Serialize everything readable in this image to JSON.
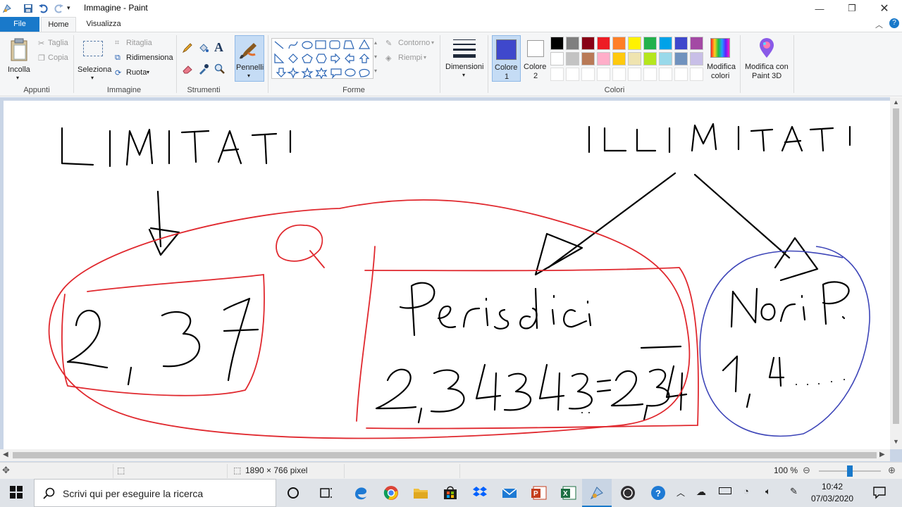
{
  "window": {
    "title": "Immagine - Paint"
  },
  "tabs": [
    {
      "label": "File"
    },
    {
      "label": "Home"
    },
    {
      "label": "Visualizza"
    }
  ],
  "ribbon": {
    "appunti": {
      "group_label": "Appunti",
      "paste_label": "Incolla",
      "cut_label": "Taglia",
      "copy_label": "Copia"
    },
    "immagine": {
      "group_label": "Immagine",
      "select_label": "Seleziona",
      "crop_label": "Ritaglia",
      "resize_label": "Ridimensiona",
      "rotate_label": "Ruota"
    },
    "strumenti": {
      "group_label": "Strumenti"
    },
    "brushes_label": "Pennelli",
    "forme": {
      "group_label": "Forme",
      "outline_label": "Contorno",
      "fill_label": "Riempi"
    },
    "size_label": "Dimensioni",
    "color1": {
      "label_line1": "Colore",
      "label_line2": "1",
      "value": "#3f48cc"
    },
    "color2": {
      "label_line1": "Colore",
      "label_line2": "2",
      "value": "#ffffff"
    },
    "colori": {
      "group_label": "Colori",
      "edit_colors_line1": "Modifica",
      "edit_colors_line2": "colori",
      "paint3d_line1": "Modifica con",
      "paint3d_line2": "Paint 3D",
      "palette_row1": [
        "#000000",
        "#7f7f7f",
        "#880015",
        "#ed1c24",
        "#ff7f27",
        "#fff200",
        "#22b14c",
        "#00a2e8",
        "#3f48cc",
        "#a349a4"
      ],
      "palette_row2": [
        "#ffffff",
        "#c3c3c3",
        "#b97a57",
        "#ffaec9",
        "#ffc90e",
        "#efe4b0",
        "#b5e61d",
        "#99d9ea",
        "#7092be",
        "#c8bfe7"
      ]
    }
  },
  "status": {
    "image_size": "1890 × 766 pixel",
    "zoom": "100 %",
    "zoom_level": 1.0
  },
  "taskbar": {
    "search_placeholder": "Scrivi qui per eseguire la ricerca",
    "time": "10:42",
    "date": "07/03/2020"
  },
  "canvas": {
    "drawn_text": [
      "LIMITATI",
      "ILLIMITATI",
      "2,37",
      "Periodici",
      "2,343434=2,34",
      "Non P.",
      "1,4......"
    ],
    "ink_colors": {
      "black": "#000000",
      "red": "#e0282e",
      "blue": "#3d45b8"
    }
  }
}
